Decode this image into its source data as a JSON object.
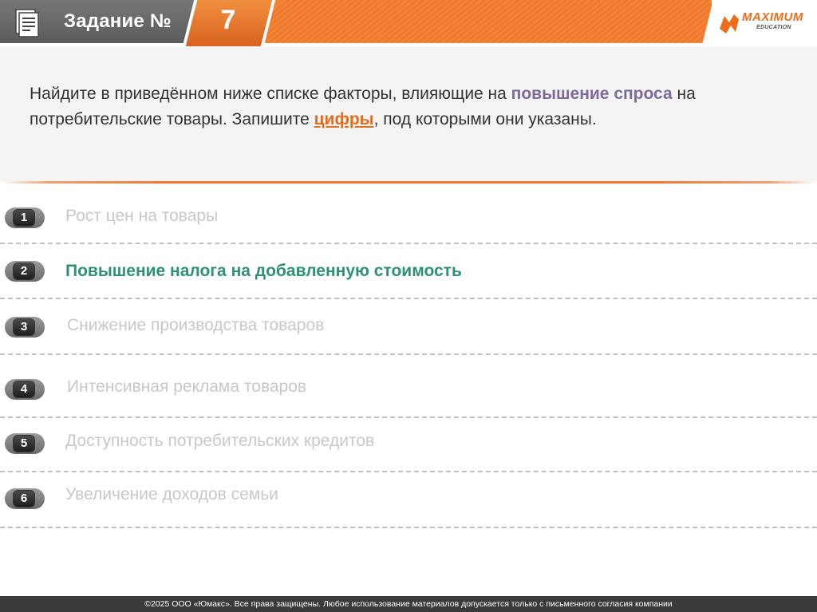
{
  "header": {
    "task_label": "Задание №",
    "task_number": "7",
    "logo_text": "MAXIMUM",
    "logo_sub": "EDUCATION"
  },
  "task": {
    "part1": "Найдите в приведённом ниже списке факторы, влияющие на ",
    "highlight1": "повышение спроса",
    "part2": " на потребительские товары. Запишите ",
    "highlight2": "цифры",
    "part3": ", под которыми они указаны."
  },
  "items": [
    {
      "num": "1",
      "text": "Рост цен на товары"
    },
    {
      "num": "2",
      "text": "Повышение налога на добавленную стоимость"
    },
    {
      "num": "3",
      "text": "Снижение производства товаров"
    },
    {
      "num": "4",
      "text": "Интенсивная реклама товаров"
    },
    {
      "num": "5",
      "text": "Доступность потребительских кредитов"
    },
    {
      "num": "6",
      "text": "Увеличение доходов семьи"
    }
  ],
  "footer": {
    "text": "©2025 ООО «Юмакс». Все права защищены. Любое использование материалов допускается только с  письменного согласия компании"
  },
  "colors": {
    "accent_orange": "#e36c1d",
    "highlight_purple": "#7d6a9c",
    "active_green": "#2e9176",
    "inactive_gray": "#c8c8c8"
  }
}
